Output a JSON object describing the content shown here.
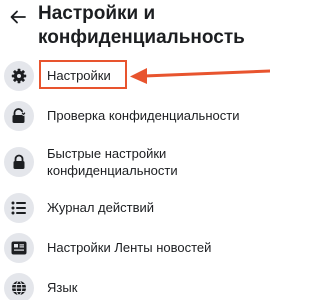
{
  "header": {
    "back_icon": "arrow-left-icon",
    "title": "Настройки и конфиденциальность"
  },
  "menu": {
    "items": [
      {
        "label": "Настройки",
        "icon": "gear-icon",
        "highlighted": true
      },
      {
        "label": "Проверка конфиденциальности",
        "icon": "lock-heart-icon"
      },
      {
        "label": "Быстрые настройки конфиденциальности",
        "icon": "lock-icon"
      },
      {
        "label": "Журнал действий",
        "icon": "list-icon"
      },
      {
        "label": "Настройки Ленты новостей",
        "icon": "news-feed-icon"
      },
      {
        "label": "Язык",
        "icon": "globe-icon"
      }
    ]
  },
  "annotation": {
    "color": "#e8542e"
  }
}
